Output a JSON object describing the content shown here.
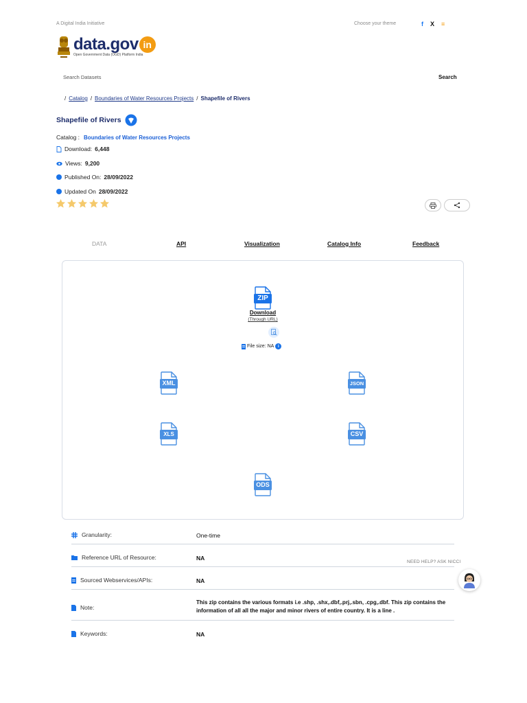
{
  "topbar": {
    "initiative": "A Digital India Initiative",
    "theme": "Choose your theme",
    "social": {
      "facebook": "f",
      "x": "X",
      "rss": "≡"
    }
  },
  "logo": {
    "text": "data.gov",
    "badge": "in",
    "subtitle": "Open Government Data (OGD) Platform India"
  },
  "search": {
    "placeholder": "Search Datasets",
    "button": "Search"
  },
  "breadcrumb": {
    "sep": "/",
    "items": [
      "Catalog",
      "Boundaries of Water Resources Projects",
      "Shapefile of Rivers"
    ]
  },
  "resource": {
    "title": "Shapefile of Rivers",
    "catalog_label": "Catalog :",
    "catalog_value": "Boundaries of Water Resources Projects",
    "download_label": "Download:",
    "download_value": "6,448",
    "views_label": "Views:",
    "views_value": "9,200",
    "published_label": "Published On:",
    "published_value": "28/09/2022",
    "updated_label": "Updated On",
    "updated_value": "28/09/2022",
    "rating": 0,
    "rating_max": 5
  },
  "tabs": [
    {
      "label": "DATA",
      "active": true
    },
    {
      "label": "API",
      "active": false
    },
    {
      "label": "Visualization",
      "active": false
    },
    {
      "label": "Catalog Info",
      "active": false
    },
    {
      "label": "Feedback",
      "active": false
    }
  ],
  "formats": {
    "zip": "ZIP",
    "download": "Download",
    "through_url": "(Through URL)",
    "file_size_label": "File size:",
    "file_size_value": "NA",
    "xml": "XML",
    "json": "JSON",
    "xls": "XLS",
    "csv": "CSV",
    "ods": "ODS"
  },
  "details": [
    {
      "label": "Granularity:",
      "value": "One-time",
      "icon": "granularity-icon"
    },
    {
      "label": "Reference URL of Resource:",
      "value": "NA",
      "icon": "folder-icon"
    },
    {
      "label": "Sourced Webservices/APIs:",
      "value": "NA",
      "icon": "document-icon"
    },
    {
      "label": "Note:",
      "value": "This zip contains the various formats i.e .shp, .shx,.dbf,.prj,.sbn, .cpg,.dbf. This zip contains the information of all all the major and minor rivers of entire country. It is a line .",
      "icon": "note-icon"
    },
    {
      "label": "Keywords:",
      "value": "NA",
      "icon": "keyword-icon"
    }
  ],
  "help": {
    "label": "NEED HELP? ASK NICCI"
  },
  "colors": {
    "brand_blue": "#1a73e8",
    "file_blue": "#4a90e2",
    "star": "#f5c96b",
    "navy": "#1d2d6b"
  }
}
